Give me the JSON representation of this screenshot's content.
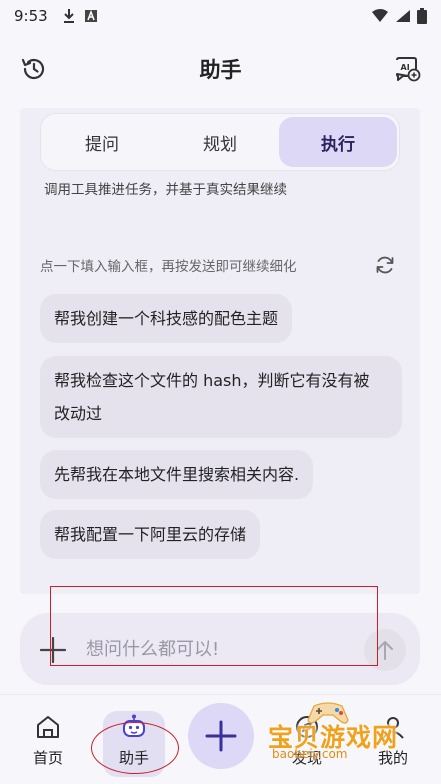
{
  "status_bar": {
    "time": "9:53"
  },
  "header": {
    "title": "助手"
  },
  "modes": {
    "tabs": [
      "提问",
      "规划",
      "执行"
    ],
    "active_index": 2,
    "description": "调用工具推进任务，并基于真实结果继续"
  },
  "suggestions": {
    "hint": "点一下填入输入框，再按发送即可继续细化",
    "items": [
      "帮我创建一个科技感的配色主题",
      "帮我检查这个文件的 hash，判断它有没有被",
      "改动过",
      "先帮我在本地文件里搜索相关内容.",
      "帮我配置一下阿里云的存储"
    ]
  },
  "input": {
    "placeholder": "想问什么都可以!"
  },
  "bottom_nav": {
    "items": [
      "首页",
      "助手",
      "发现",
      "我的"
    ],
    "active_index": 1
  },
  "watermark": {
    "title": "宝贝游戏网",
    "url": "baobeiy.com"
  },
  "colors": {
    "accent": "#dcd8f5",
    "annotation": "#c9202a"
  }
}
